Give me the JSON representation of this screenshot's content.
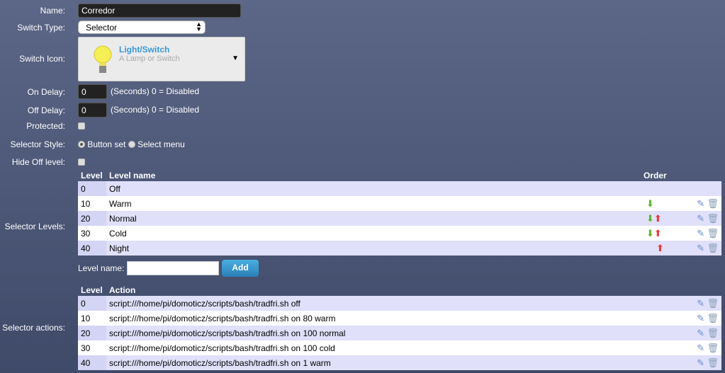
{
  "labels": {
    "name": "Name:",
    "switch_type": "Switch Type:",
    "switch_icon": "Switch Icon:",
    "on_delay": "On Delay:",
    "off_delay": "Off Delay:",
    "protected": "Protected:",
    "selector_style": "Selector Style:",
    "hide_off": "Hide Off level:",
    "selector_levels": "Selector Levels:",
    "selector_actions": "Selector actions:"
  },
  "name_value": "Corredor",
  "switch_type": "Selector",
  "icon": {
    "title": "Light/Switch",
    "subtitle": "A Lamp or Switch",
    "icon": "lightbulb-icon"
  },
  "on_delay": "0",
  "off_delay": "0",
  "delay_hint": "(Seconds) 0 = Disabled",
  "protected": false,
  "hide_off": false,
  "selector_style": {
    "options": [
      "Button set",
      "Select menu"
    ],
    "selected": "Button set"
  },
  "levels": {
    "headers": {
      "level": "Level",
      "name": "Level name",
      "order": "Order"
    },
    "rows": [
      {
        "level": "0",
        "name": "Off",
        "down": false,
        "up": false,
        "editable": false
      },
      {
        "level": "10",
        "name": "Warm",
        "down": true,
        "up": false,
        "editable": true
      },
      {
        "level": "20",
        "name": "Normal",
        "down": true,
        "up": true,
        "editable": true
      },
      {
        "level": "30",
        "name": "Cold",
        "down": true,
        "up": true,
        "editable": true
      },
      {
        "level": "40",
        "name": "Night",
        "down": false,
        "up": true,
        "editable": true
      }
    ]
  },
  "add_level": {
    "label": "Level name:",
    "value": "",
    "button": "Add"
  },
  "actions": {
    "headers": {
      "level": "Level",
      "action": "Action"
    },
    "rows": [
      {
        "level": "0",
        "action": "script:///home/pi/domoticz/scripts/bash/tradfri.sh off"
      },
      {
        "level": "10",
        "action": "script:///home/pi/domoticz/scripts/bash/tradfri.sh on 80 warm"
      },
      {
        "level": "20",
        "action": "script:///home/pi/domoticz/scripts/bash/tradfri.sh on 100 normal"
      },
      {
        "level": "30",
        "action": "script:///home/pi/domoticz/scripts/bash/tradfri.sh on 100 cold"
      },
      {
        "level": "40",
        "action": "script:///home/pi/domoticz/scripts/bash/tradfri.sh on 1 warm"
      }
    ]
  }
}
